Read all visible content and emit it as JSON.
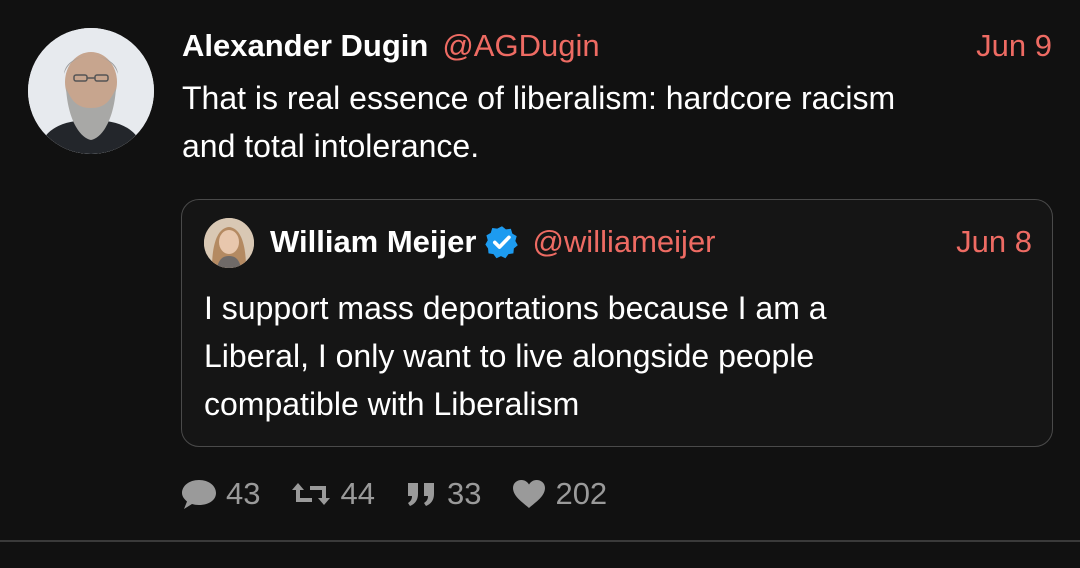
{
  "tweet": {
    "author": {
      "name": "Alexander Dugin",
      "handle": "@AGDugin",
      "avatar_icon": "avatar-photo-bearded-man"
    },
    "date": "Jun 9",
    "text": "That is real essence of liberalism: hardcore racism\nand total intolerance.",
    "quoted": {
      "author": {
        "name": "William Meijer",
        "handle": "@williameijer",
        "verified": true,
        "avatar_icon": "avatar-photo-long-hair"
      },
      "date": "Jun 8",
      "text": "I support mass deportations because I am a\nLiberal, I only want to live alongside people\ncompatible with Liberalism"
    },
    "stats": {
      "replies": "43",
      "retweets": "44",
      "quotes": "33",
      "likes": "202"
    }
  },
  "colors": {
    "background": "#111111",
    "text": "#ffffff",
    "accent": "#ee6b63",
    "muted": "#9a9a9a",
    "verified": "#1d9bf0",
    "border": "#4a4a4a"
  }
}
